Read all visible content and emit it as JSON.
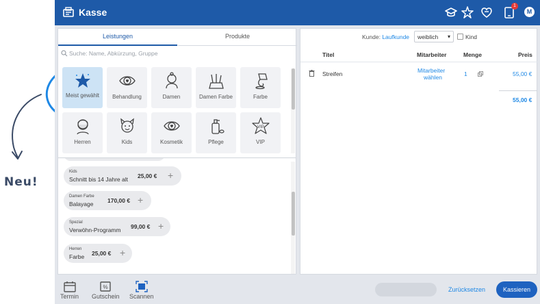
{
  "annotation": {
    "text": "Neu!"
  },
  "header": {
    "title": "Kasse",
    "notification_count": "1",
    "avatar_initial": "M",
    "icons": [
      "kasse-icon",
      "graduation-cap-icon",
      "star-sparkle-icon",
      "heart-shield-icon",
      "tablet-icon"
    ]
  },
  "left": {
    "tabs": [
      {
        "label": "Leistungen"
      },
      {
        "label": "Produkte"
      }
    ],
    "search_placeholder": "Suche: Name, Abkürzung, Gruppe",
    "tiles": [
      {
        "label": "Meist gewählt",
        "icon": "star-icon",
        "active": true
      },
      {
        "label": "Behandlung",
        "icon": "eye-heart-icon"
      },
      {
        "label": "Damen",
        "icon": "woman-icon"
      },
      {
        "label": "Damen Farbe",
        "icon": "brushes-icon"
      },
      {
        "label": "Farbe",
        "icon": "paint-pour-icon"
      },
      {
        "label": "Herren",
        "icon": "man-beard-icon"
      },
      {
        "label": "Kids",
        "icon": "child-icon"
      },
      {
        "label": "Kosmetik",
        "icon": "eye-heart-icon"
      },
      {
        "label": "Pflege",
        "icon": "bottle-icon"
      },
      {
        "label": "VIP",
        "icon": "vip-star-icon"
      }
    ],
    "services": [
      {
        "category": "Kids",
        "name": "Schnitt bis 14 Jahre alt",
        "price": "25,00 €"
      },
      {
        "category": "Damen Farbe",
        "name": "Balayage",
        "price": "170,00 €"
      },
      {
        "category": "Spezial",
        "name": "Verwöhn-Programm",
        "price": "99,00 €"
      },
      {
        "category": "Herren",
        "name": "Farbe",
        "price": "25,00 €"
      }
    ]
  },
  "right": {
    "kunde_label": "Kunde:",
    "kunde_value": "Laufkunde",
    "gender": "weiblich",
    "kind_label": "Kind",
    "columns": {
      "titel": "Titel",
      "mitarbeiter": "Mitarbeiter",
      "menge": "Menge",
      "preis": "Preis"
    },
    "rows": [
      {
        "titel": "Streifen",
        "mitarbeiter_line1": "Mitarbeiter",
        "mitarbeiter_line2": "wählen",
        "menge": "1",
        "preis": "55,00 €"
      }
    ],
    "total": "55,00 €"
  },
  "bottom": {
    "termin": "Termin",
    "gutschein": "Gutschein",
    "scannen": "Scannen",
    "reset": "Zurücksetzen",
    "pay": "Kassieren"
  },
  "colors": {
    "header": "#1e5aa8",
    "accent": "#1e88e5",
    "annotation": "#3a4a66",
    "highlight_tile": "#cde3f5"
  }
}
